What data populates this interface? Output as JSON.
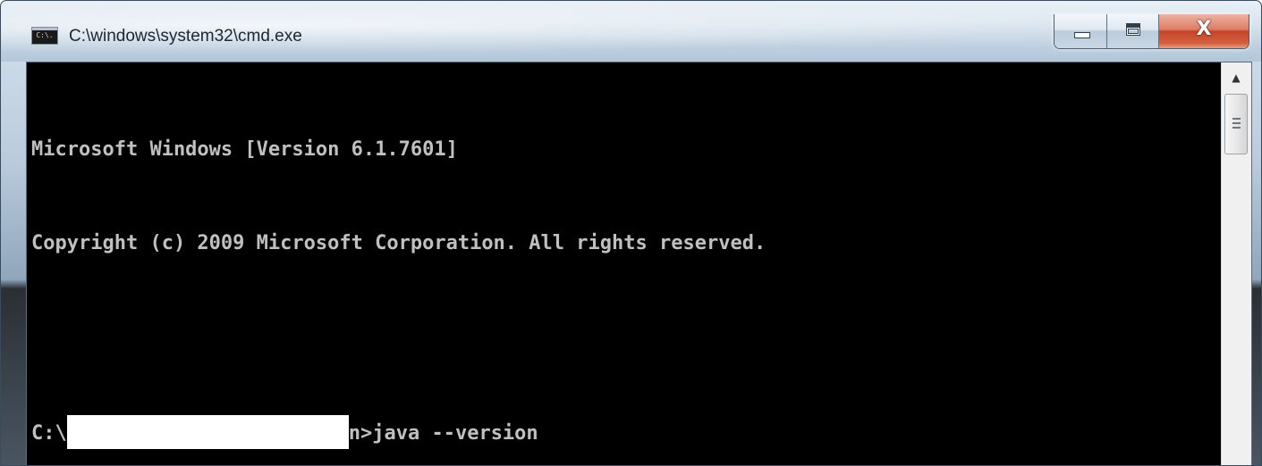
{
  "window": {
    "title": "C:\\windows\\system32\\cmd.exe",
    "icon": "console-app-icon",
    "icon_text": "C:\\."
  },
  "controls": {
    "minimize": "minimize-icon",
    "maximize": "maximize-icon",
    "close": "close-icon",
    "close_glyph": "X"
  },
  "console": {
    "line1": "Microsoft Windows [Version 6.1.7601]",
    "line2": "Copyright (c) 2009 Microsoft Corporation. All rights reserved.",
    "line3": "",
    "prompt_prefix": "C:\\",
    "prompt_suffix": "n>java --version",
    "text_color": "#c0c0c0",
    "background_color": "#000000"
  },
  "scrollbar": {
    "up_arrow": "▲"
  }
}
